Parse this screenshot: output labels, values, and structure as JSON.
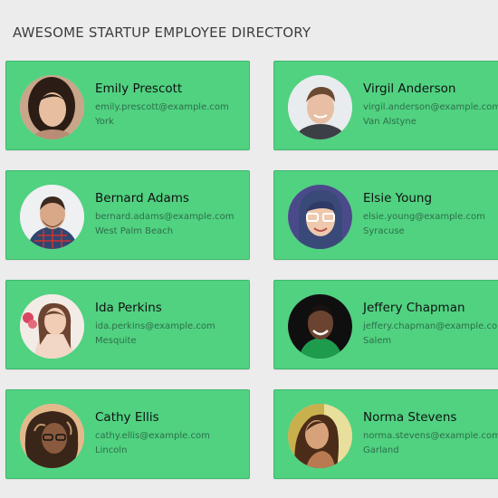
{
  "header": {
    "title": "AWESOME STARTUP EMPLOYEE DIRECTORY"
  },
  "employees": [
    {
      "name": "Emily Prescott",
      "email": "emily.prescott@example.com",
      "city": "York"
    },
    {
      "name": "Virgil Anderson",
      "email": "virgil.anderson@example.com",
      "city": "Van Alstyne"
    },
    {
      "name": "Bernard Adams",
      "email": "bernard.adams@example.com",
      "city": "West Palm Beach"
    },
    {
      "name": "Elsie Young",
      "email": "elsie.young@example.com",
      "city": "Syracuse"
    },
    {
      "name": "Ida Perkins",
      "email": "ida.perkins@example.com",
      "city": "Mesquite"
    },
    {
      "name": "Jeffery Chapman",
      "email": "jeffery.chapman@example.com",
      "city": "Salem"
    },
    {
      "name": "Cathy Ellis",
      "email": "cathy.ellis@example.com",
      "city": "Lincoln"
    },
    {
      "name": "Norma Stevens",
      "email": "norma.stevens@example.com",
      "city": "Garland"
    }
  ],
  "colors": {
    "page_background": "#ececec",
    "card_background": "#50d281",
    "card_border": "#3fb86c",
    "name_text": "#111111",
    "detail_text": "#2f6d48",
    "title_text": "#3e3e3e"
  }
}
